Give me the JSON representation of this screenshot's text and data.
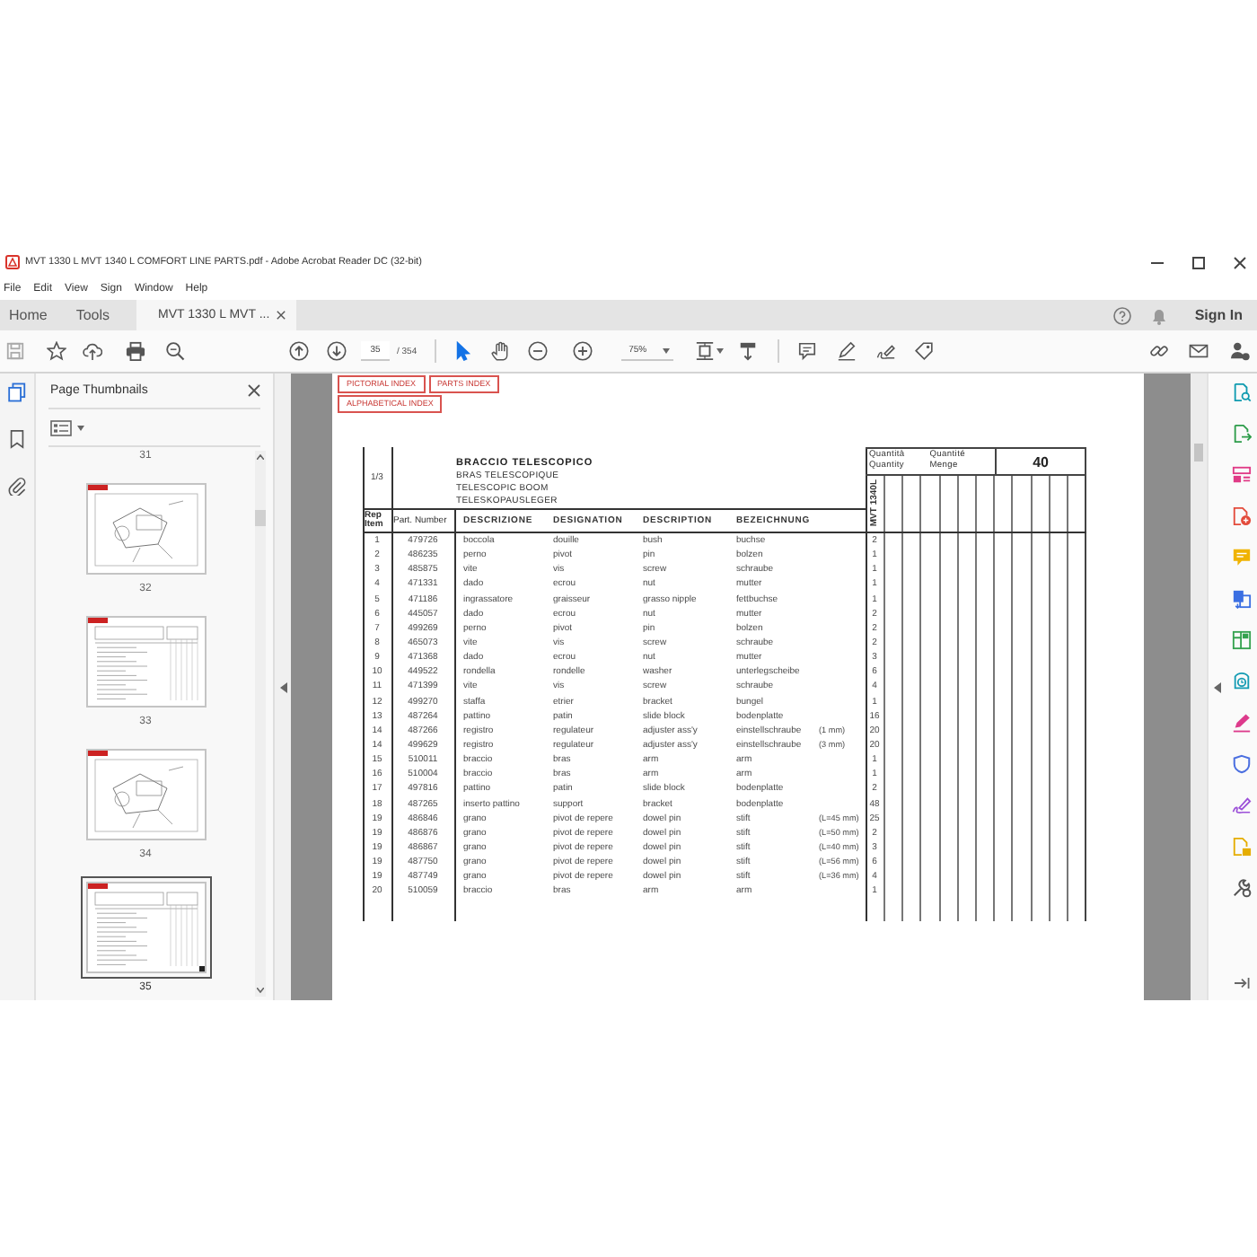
{
  "window": {
    "title": "MVT 1330 L MVT 1340 L COMFORT LINE PARTS.pdf - Adobe Acrobat Reader DC (32-bit)"
  },
  "menu": [
    "File",
    "Edit",
    "View",
    "Sign",
    "Window",
    "Help"
  ],
  "tabs": [
    {
      "label": "Home",
      "kind": "nav",
      "selected": false
    },
    {
      "label": "Tools",
      "kind": "nav",
      "selected": false
    },
    {
      "label": "MVT 1330 L MVT ...",
      "kind": "document",
      "selected": true
    }
  ],
  "account": {
    "sign_in": "Sign In"
  },
  "toolbar": {
    "page": "35",
    "page_count": "/ 354",
    "zoom": "75%",
    "tools": [
      {
        "kind": "select",
        "selected": true
      },
      {
        "kind": "hand",
        "selected": false
      }
    ]
  },
  "side_panel": {
    "title": "Page Thumbnails",
    "thumbnails": [
      {
        "label": "31",
        "selected": false
      },
      {
        "label": "32",
        "kind": "diagram",
        "selected": false
      },
      {
        "label": "33",
        "kind": "table",
        "selected": false
      },
      {
        "label": "34",
        "kind": "diagram",
        "selected": false
      },
      {
        "label": "35",
        "kind": "table",
        "selected": true
      }
    ]
  },
  "document": {
    "index_links": [
      "PICTORIAL INDEX",
      "PARTS INDEX",
      "ALPHABETICAL INDEX"
    ],
    "sheet": "1/3",
    "titles": [
      "BRACCIO TELESCOPICO",
      "BRAS TELESCOPIQUE",
      "TELESCOPIC BOOM",
      "TELESKOPAUSLEGER"
    ],
    "quantity_labels": [
      {
        "lines": [
          "Quantità",
          "Quantity"
        ]
      },
      {
        "lines": [
          "Quantité",
          "Menge"
        ]
      }
    ],
    "quantity_value": "40",
    "model": "MVT 1340L",
    "columns": [
      "Rep Item",
      "Part. Number",
      "DESCRIZIONE",
      "DESIGNATION",
      "DESCRIPTION",
      "BEZEICHNUNG"
    ],
    "rows": [
      {
        "rep": "1",
        "part_number": "479726",
        "descrizione": "boccola",
        "designation": "douille",
        "description": "bush",
        "bezeichnung": "buchse",
        "quantity": "2"
      },
      {
        "rep": "2",
        "part_number": "486235",
        "descrizione": "perno",
        "designation": "pivot",
        "description": "pin",
        "bezeichnung": "bolzen",
        "quantity": "1"
      },
      {
        "rep": "3",
        "part_number": "485875",
        "descrizione": "vite",
        "designation": "vis",
        "description": "screw",
        "bezeichnung": "schraube",
        "quantity": "1"
      },
      {
        "rep": "4",
        "part_number": "471331",
        "descrizione": "dado",
        "designation": "ecrou",
        "description": "nut",
        "bezeichnung": "mutter",
        "quantity": "1"
      },
      {
        "rep": "5",
        "part_number": "471186",
        "descrizione": "ingrassatore",
        "designation": "graisseur",
        "description": "grasso nipple",
        "bezeichnung": "fettbuchse",
        "quantity": "1"
      },
      {
        "rep": "6",
        "part_number": "445057",
        "descrizione": "dado",
        "designation": "ecrou",
        "description": "nut",
        "bezeichnung": "mutter",
        "quantity": "2"
      },
      {
        "rep": "7",
        "part_number": "499269",
        "descrizione": "perno",
        "designation": "pivot",
        "description": "pin",
        "bezeichnung": "bolzen",
        "quantity": "2"
      },
      {
        "rep": "8",
        "part_number": "465073",
        "descrizione": "vite",
        "designation": "vis",
        "description": "screw",
        "bezeichnung": "schraube",
        "quantity": "2"
      },
      {
        "rep": "9",
        "part_number": "471368",
        "descrizione": "dado",
        "designation": "ecrou",
        "description": "nut",
        "bezeichnung": "mutter",
        "quantity": "3"
      },
      {
        "rep": "10",
        "part_number": "449522",
        "descrizione": "rondella",
        "designation": "rondelle",
        "description": "washer",
        "bezeichnung": "unterlegscheibe",
        "quantity": "6"
      },
      {
        "rep": "11",
        "part_number": "471399",
        "descrizione": "vite",
        "designation": "vis",
        "description": "screw",
        "bezeichnung": "schraube",
        "quantity": "4"
      },
      {
        "rep": "12",
        "part_number": "499270",
        "descrizione": "staffa",
        "designation": "etrier",
        "description": "bracket",
        "bezeichnung": "bungel",
        "quantity": "1"
      },
      {
        "rep": "13",
        "part_number": "487264",
        "descrizione": "pattino",
        "designation": "patin",
        "description": "slide block",
        "bezeichnung": "bodenplatte",
        "quantity": "16"
      },
      {
        "rep": "14",
        "part_number": "487266",
        "descrizione": "registro",
        "designation": "regulateur",
        "description": "adjuster ass'y",
        "bezeichnung": "einstellschraube",
        "column_7": "(1 mm)",
        "quantity": "20"
      },
      {
        "rep": "14",
        "part_number": "499629",
        "descrizione": "registro",
        "designation": "regulateur",
        "description": "adjuster ass'y",
        "bezeichnung": "einstellschraube",
        "column_7": "(3 mm)",
        "quantity": "20"
      },
      {
        "rep": "15",
        "part_number": "510011",
        "descrizione": "braccio",
        "designation": "bras",
        "description": "arm",
        "bezeichnung": "arm",
        "quantity": "1"
      },
      {
        "rep": "16",
        "part_number": "510004",
        "descrizione": "braccio",
        "designation": "bras",
        "description": "arm",
        "bezeichnung": "arm",
        "quantity": "1"
      },
      {
        "rep": "17",
        "part_number": "497816",
        "descrizione": "pattino",
        "designation": "patin",
        "description": "slide block",
        "bezeichnung": "bodenplatte",
        "quantity": "2"
      },
      {
        "rep": "18",
        "part_number": "487265",
        "descrizione": "inserto pattino",
        "designation": "support",
        "description": "bracket",
        "bezeichnung": "bodenplatte",
        "quantity": "48"
      },
      {
        "rep": "19",
        "part_number": "486846",
        "descrizione": "grano",
        "designation": "pivot de repere",
        "description": "dowel pin",
        "bezeichnung": "stift",
        "column_7": "(L=45 mm)",
        "quantity": "25"
      },
      {
        "rep": "19",
        "part_number": "486876",
        "descrizione": "grano",
        "designation": "pivot de repere",
        "description": "dowel pin",
        "bezeichnung": "stift",
        "column_7": "(L=50 mm)",
        "quantity": "2"
      },
      {
        "rep": "19",
        "part_number": "486867",
        "descrizione": "grano",
        "designation": "pivot de repere",
        "description": "dowel pin",
        "bezeichnung": "stift",
        "column_7": "(L=40 mm)",
        "quantity": "3"
      },
      {
        "rep": "19",
        "part_number": "487750",
        "descrizione": "grano",
        "designation": "pivot de repere",
        "description": "dowel pin",
        "bezeichnung": "stift",
        "column_7": "(L=56 mm)",
        "quantity": "6"
      },
      {
        "rep": "19",
        "part_number": "487749",
        "descrizione": "grano",
        "designation": "pivot de repere",
        "description": "dowel pin",
        "bezeichnung": "stift",
        "column_7": "(L=36 mm)",
        "quantity": "4"
      },
      {
        "rep": "20",
        "part_number": "510059",
        "descrizione": "braccio",
        "designation": "bras",
        "description": "arm",
        "bezeichnung": "arm",
        "quantity": "1"
      }
    ]
  }
}
